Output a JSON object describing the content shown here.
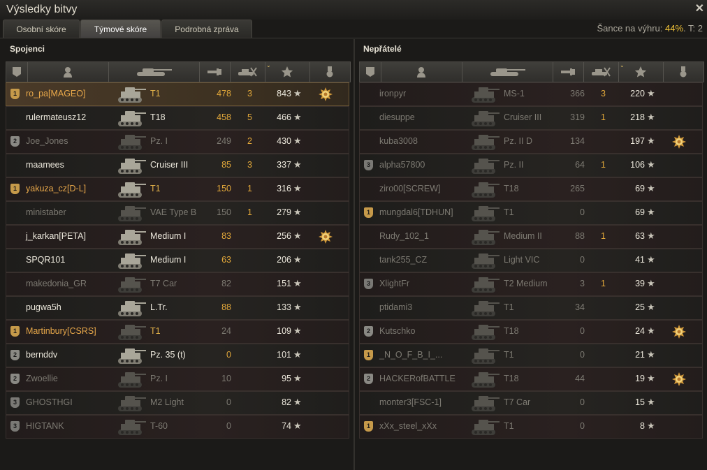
{
  "window": {
    "title": "Výsledky bitvy",
    "close_label": "✕"
  },
  "tabs": [
    {
      "label": "Osobní skóre",
      "active": false
    },
    {
      "label": "Týmové skóre",
      "active": true
    },
    {
      "label": "Podrobná zpráva",
      "active": false
    }
  ],
  "chance": {
    "prefix": "Šance na výhru: ",
    "value": "44%",
    "suffix": ". T: 2"
  },
  "allies": {
    "title": "Spojenci",
    "rows": [
      {
        "badge": "1",
        "player": "ro_pa[MAGEO]",
        "tank": "T1",
        "damage": "478",
        "kills": "3",
        "xp": "843",
        "medal": true,
        "alive": true,
        "me": true
      },
      {
        "badge": "",
        "player": "rulermateusz12",
        "tank": "T18",
        "damage": "458",
        "kills": "5",
        "xp": "466",
        "medal": false,
        "alive": true
      },
      {
        "badge": "2",
        "player": "Joe_Jones",
        "tank": "Pz. I",
        "damage": "249",
        "kills": "2",
        "xp": "430",
        "medal": false,
        "alive": false
      },
      {
        "badge": "",
        "player": "maamees",
        "tank": "Cruiser III",
        "damage": "85",
        "kills": "3",
        "xp": "337",
        "medal": false,
        "alive": true
      },
      {
        "badge": "1",
        "player": "yakuza_cz[D-L]",
        "tank": "T1",
        "damage": "150",
        "kills": "1",
        "xp": "316",
        "medal": false,
        "alive": true,
        "gold": true
      },
      {
        "badge": "",
        "player": "ministaber",
        "tank": "VAE Type B",
        "damage": "150",
        "kills": "1",
        "xp": "279",
        "medal": false,
        "alive": false
      },
      {
        "badge": "",
        "player": "j_karkan[PETA]",
        "tank": "Medium I",
        "damage": "83",
        "kills": "",
        "xp": "256",
        "medal": true,
        "alive": true
      },
      {
        "badge": "",
        "player": "SPQR101",
        "tank": "Medium I",
        "damage": "63",
        "kills": "",
        "xp": "206",
        "medal": false,
        "alive": true
      },
      {
        "badge": "",
        "player": "makedonia_GR",
        "tank": "T7 Car",
        "damage": "82",
        "kills": "",
        "xp": "151",
        "medal": false,
        "alive": false
      },
      {
        "badge": "",
        "player": "pugwa5h",
        "tank": "L.Tr.",
        "damage": "88",
        "kills": "",
        "xp": "133",
        "medal": false,
        "alive": true
      },
      {
        "badge": "1",
        "player": "Martinbury[CSRS]",
        "tank": "T1",
        "damage": "24",
        "kills": "",
        "xp": "109",
        "medal": false,
        "alive": false,
        "gold": true
      },
      {
        "badge": "2",
        "player": "bernddv",
        "tank": "Pz. 35 (t)",
        "damage": "0",
        "kills": "",
        "xp": "101",
        "medal": false,
        "alive": true
      },
      {
        "badge": "2",
        "player": "Zwoellie",
        "tank": "Pz. I",
        "damage": "10",
        "kills": "",
        "xp": "95",
        "medal": false,
        "alive": false
      },
      {
        "badge": "3",
        "player": "GHOSTHGI",
        "tank": "M2 Light",
        "damage": "0",
        "kills": "",
        "xp": "82",
        "medal": false,
        "alive": false
      },
      {
        "badge": "3",
        "player": "HIGTANK",
        "tank": "T-60",
        "damage": "0",
        "kills": "",
        "xp": "74",
        "medal": false,
        "alive": false
      }
    ]
  },
  "enemies": {
    "title": "Nepřátelé",
    "rows": [
      {
        "badge": "",
        "player": "ironpyr",
        "tank": "MS-1",
        "damage": "366",
        "kills": "3",
        "xp": "220",
        "medal": false,
        "alive": false
      },
      {
        "badge": "",
        "player": "diesuppe",
        "tank": "Cruiser III",
        "damage": "319",
        "kills": "1",
        "xp": "218",
        "medal": false,
        "alive": false
      },
      {
        "badge": "",
        "player": "kuba3008",
        "tank": "Pz. II D",
        "damage": "134",
        "kills": "",
        "xp": "197",
        "medal": true,
        "alive": false
      },
      {
        "badge": "3",
        "player": "alpha57800",
        "tank": "Pz. II",
        "damage": "64",
        "kills": "1",
        "xp": "106",
        "medal": false,
        "alive": false
      },
      {
        "badge": "",
        "player": "ziro00[SCREW]",
        "tank": "T18",
        "damage": "265",
        "kills": "",
        "xp": "69",
        "medal": false,
        "alive": false
      },
      {
        "badge": "1",
        "player": "mungdal6[TDHUN]",
        "tank": "T1",
        "damage": "0",
        "kills": "",
        "xp": "69",
        "medal": false,
        "alive": false
      },
      {
        "badge": "",
        "player": "Rudy_102_1",
        "tank": "Medium II",
        "damage": "88",
        "kills": "1",
        "xp": "63",
        "medal": false,
        "alive": false
      },
      {
        "badge": "",
        "player": "tank255_CZ",
        "tank": "Light VIC",
        "damage": "0",
        "kills": "",
        "xp": "41",
        "medal": false,
        "alive": false
      },
      {
        "badge": "3",
        "player": "XlightFr",
        "tank": "T2 Medium",
        "damage": "3",
        "kills": "1",
        "xp": "39",
        "medal": false,
        "alive": false
      },
      {
        "badge": "",
        "player": "ptidami3",
        "tank": "T1",
        "damage": "34",
        "kills": "",
        "xp": "25",
        "medal": false,
        "alive": false
      },
      {
        "badge": "2",
        "player": "Kutschko",
        "tank": "T18",
        "damage": "0",
        "kills": "",
        "xp": "24",
        "medal": true,
        "alive": false
      },
      {
        "badge": "1",
        "player": "_N_O_F_B_I_...",
        "tank": "T1",
        "damage": "0",
        "kills": "",
        "xp": "21",
        "medal": false,
        "alive": false
      },
      {
        "badge": "2",
        "player": "HACKERofBATTLE",
        "tank": "T18",
        "damage": "44",
        "kills": "",
        "xp": "19",
        "medal": true,
        "alive": false
      },
      {
        "badge": "",
        "player": "monter3[FSC-1]",
        "tank": "T7 Car",
        "damage": "0",
        "kills": "",
        "xp": "15",
        "medal": false,
        "alive": false
      },
      {
        "badge": "1",
        "player": "xXx_steel_xXx",
        "tank": "T1",
        "damage": "0",
        "kills": "",
        "xp": "8",
        "medal": false,
        "alive": false
      }
    ]
  },
  "icons": {
    "star": "★",
    "columns": [
      "squad-icon",
      "player-icon",
      "tank-icon",
      "damage-icon",
      "kills-icon",
      "xp-icon",
      "medal-icon"
    ]
  }
}
